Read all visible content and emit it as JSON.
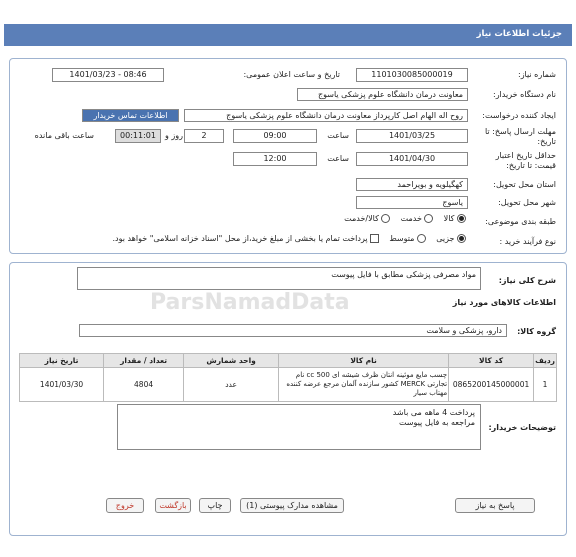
{
  "header": {
    "title": "جزئیات اطلاعات نیاز"
  },
  "form": {
    "need_number_label": "شماره نیاز:",
    "need_number": "1101030085000019",
    "announce_label": "تاریخ و ساعت اعلان عمومی:",
    "announce_value": "1401/03/23 - 08:46",
    "buyer_org_label": "نام دستگاه خریدار:",
    "buyer_org": "معاونت درمان دانشگاه علوم پزشکی یاسوج",
    "creator_label": "ایجاد کننده درخواست:",
    "creator": "روح اله الهام اصل کارپرداز معاونت درمان دانشگاه علوم پزشکی یاسوج",
    "contact_link": "اطلاعات تماس خریدار",
    "reply_deadline_label": "مهلت ارسال پاسخ: تا تاریخ:",
    "reply_date": "1401/03/25",
    "time_label": "ساعت",
    "reply_time": "09:00",
    "days_value": "2",
    "days_label": "روز و",
    "remaining_time": "00:11:01",
    "remaining_label": "ساعت باقی مانده",
    "validity_label": "حداقل تاریخ اعتبار قیمت: تا تاریخ:",
    "validity_date": "1401/04/30",
    "validity_time_label": "ساعت",
    "validity_time": "12:00",
    "province_label": "استان محل تحویل:",
    "province": "کهگیلویه و بویراحمد",
    "city_label": "شهر محل تحویل:",
    "city": "یاسوج",
    "category_label": "طبقه بندی موضوعی:",
    "category_options": [
      "کالا",
      "خدمت",
      "کالا/خدمت"
    ],
    "process_label": "نوع فرآیند خرید :",
    "process_options": [
      "جزیی",
      "متوسط"
    ],
    "payment_note": "پرداخت تمام یا بخشی از مبلغ خرید،از محل \"اسناد خزانه اسلامی\" خواهد بود."
  },
  "details": {
    "summary_label": "شرح کلی نیاز:",
    "summary": "مواد مصرفی پزشکی مطابق با فایل پیوست",
    "items_heading": "اطلاعات کالاهای مورد نیاز",
    "group_label": "گروه کالا:",
    "group": "دارو، پزشکی و سلامت",
    "columns": [
      "ردیف",
      "کد کالا",
      "نام کالا",
      "واحد شمارش",
      "تعداد / مقدار",
      "تاریخ نیاز"
    ],
    "row": {
      "index": "1",
      "code": "0865200145000001",
      "name": "چسب مایع موئینه انتان ظرف شیشه ای 500 cc نام تجارتی MERCK کشور سازنده آلمان مرجع عرضه کننده مهتاب سیار",
      "unit": "عدد",
      "qty": "4804",
      "date": "1401/03/30"
    },
    "buyer_notes_label": "توضیحات خریدار:",
    "buyer_notes_line1": "پرداخت 4 ماهه می باشد",
    "buyer_notes_line2": "مراجعه به فایل پیوست"
  },
  "buttons": {
    "reply": "پاسخ به نیاز",
    "view_docs": "مشاهده مدارک پیوستی (1)",
    "print": "چاپ",
    "back": "بازگشت",
    "exit": "خروج"
  },
  "watermark": {
    "brand": "ParsNamadData"
  }
}
